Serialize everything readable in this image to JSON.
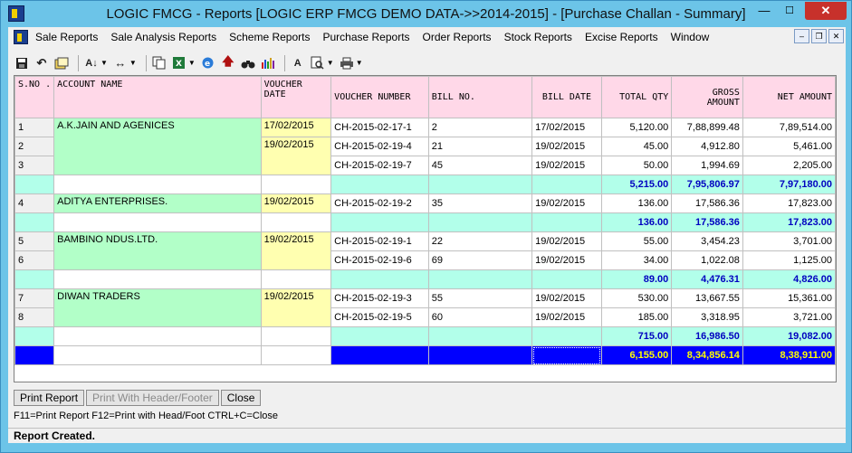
{
  "window": {
    "title": "LOGIC FMCG - Reports  [LOGIC ERP FMCG DEMO DATA->>2014-2015] - [Purchase Challan - Summary]"
  },
  "menu": {
    "items": [
      "Sale Reports",
      "Sale Analysis Reports",
      "Scheme Reports",
      "Purchase Reports",
      "Order Reports",
      "Stock Reports",
      "Excise Reports",
      "Window"
    ]
  },
  "table": {
    "headers": {
      "sno": "S.NO .",
      "account": "ACCOUNT NAME",
      "vdate": "VOUCHER DATE",
      "vnum": "VOUCHER NUMBER",
      "bill": "BILL NO.",
      "bdate": "BILL DATE",
      "qty": "TOTAL QTY",
      "gross": "GROSS AMOUNT",
      "net": "NET AMOUNT"
    },
    "groups": [
      {
        "account": "A.K.JAIN AND AGENICES",
        "dates": [
          "17/02/2015",
          "19/02/2015"
        ],
        "rows": [
          {
            "sno": "1",
            "vnum": "CH-2015-02-17-1",
            "bill": "2",
            "bdate": "17/02/2015",
            "qty": "5,120.00",
            "gross": "7,88,899.48",
            "net": "7,89,514.00"
          },
          {
            "sno": "2",
            "vnum": "CH-2015-02-19-4",
            "bill": "21",
            "bdate": "19/02/2015",
            "qty": "45.00",
            "gross": "4,912.80",
            "net": "5,461.00"
          },
          {
            "sno": "3",
            "vnum": "CH-2015-02-19-7",
            "bill": "45",
            "bdate": "19/02/2015",
            "qty": "50.00",
            "gross": "1,994.69",
            "net": "2,205.00"
          }
        ],
        "subtotal": {
          "qty": "5,215.00",
          "gross": "7,95,806.97",
          "net": "7,97,180.00"
        }
      },
      {
        "account": "ADITYA ENTERPRISES.",
        "dates": [
          "19/02/2015"
        ],
        "rows": [
          {
            "sno": "4",
            "vnum": "CH-2015-02-19-2",
            "bill": "35",
            "bdate": "19/02/2015",
            "qty": "136.00",
            "gross": "17,586.36",
            "net": "17,823.00"
          }
        ],
        "subtotal": {
          "qty": "136.00",
          "gross": "17,586.36",
          "net": "17,823.00"
        }
      },
      {
        "account": "BAMBINO NDUS.LTD.",
        "dates": [
          "19/02/2015"
        ],
        "rows": [
          {
            "sno": "5",
            "vnum": "CH-2015-02-19-1",
            "bill": "22",
            "bdate": "19/02/2015",
            "qty": "55.00",
            "gross": "3,454.23",
            "net": "3,701.00"
          },
          {
            "sno": "6",
            "vnum": "CH-2015-02-19-6",
            "bill": "69",
            "bdate": "19/02/2015",
            "qty": "34.00",
            "gross": "1,022.08",
            "net": "1,125.00"
          }
        ],
        "subtotal": {
          "qty": "89.00",
          "gross": "4,476.31",
          "net": "4,826.00"
        }
      },
      {
        "account": "DIWAN TRADERS",
        "dates": [
          "19/02/2015"
        ],
        "rows": [
          {
            "sno": "7",
            "vnum": "CH-2015-02-19-3",
            "bill": "55",
            "bdate": "19/02/2015",
            "qty": "530.00",
            "gross": "13,667.55",
            "net": "15,361.00"
          },
          {
            "sno": "8",
            "vnum": "CH-2015-02-19-5",
            "bill": "60",
            "bdate": "19/02/2015",
            "qty": "185.00",
            "gross": "3,318.95",
            "net": "3,721.00"
          }
        ],
        "subtotal": {
          "qty": "715.00",
          "gross": "16,986.50",
          "net": "19,082.00"
        }
      }
    ],
    "grand_total": {
      "qty": "6,155.00",
      "gross": "8,34,856.14",
      "net": "8,38,911.00"
    }
  },
  "buttons": {
    "print_report": "Print Report",
    "print_header": "Print With Header/Footer",
    "close": "Close"
  },
  "hint": "F11=Print Report  F12=Print with Head/Foot  CTRL+C=Close",
  "status": "Report Created.",
  "colors": {
    "header": "#ffd8e8",
    "account": "#b2ffc8",
    "date": "#ffffb0",
    "subtotal": "#b2ffea",
    "grand": "#0000ff",
    "grand_text": "#ffff00"
  }
}
